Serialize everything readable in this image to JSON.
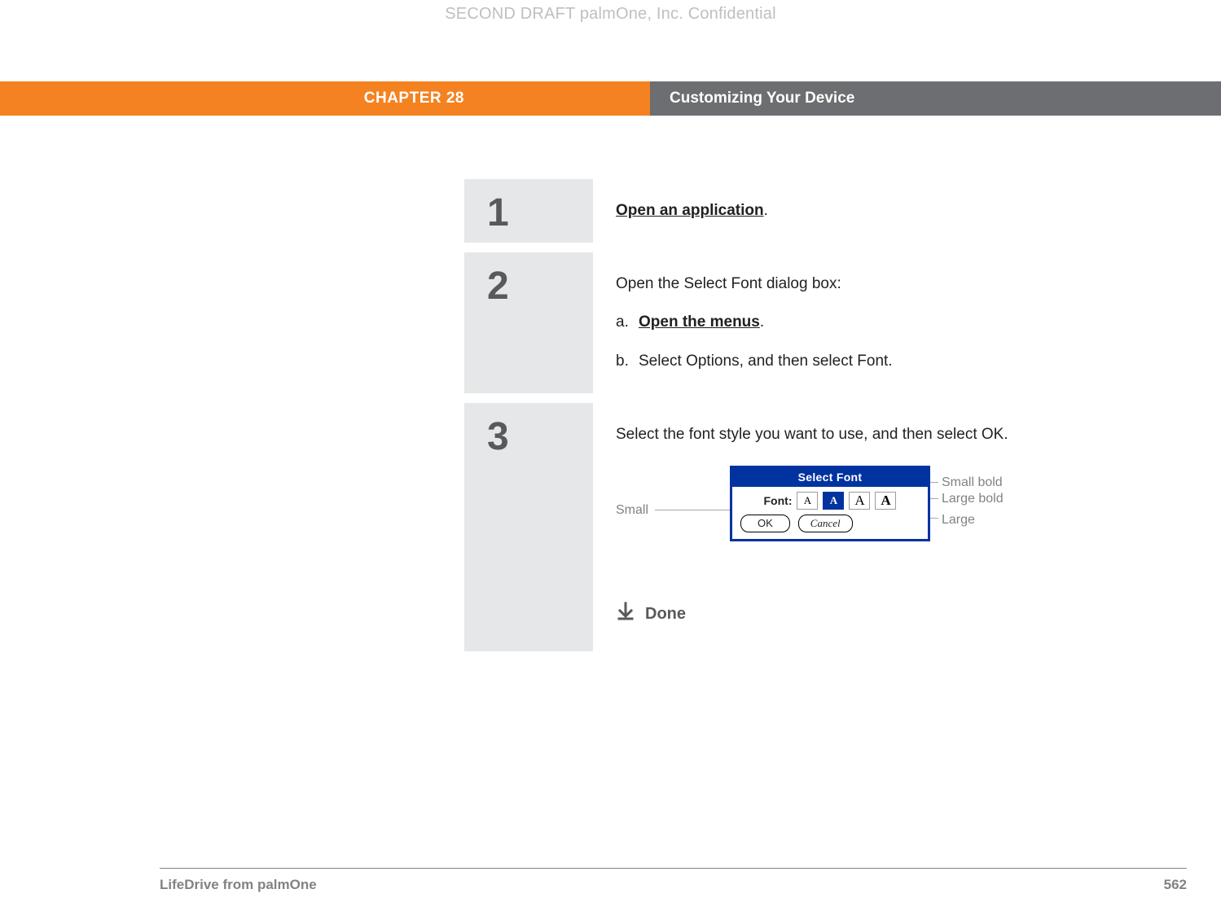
{
  "watermark": "SECOND DRAFT palmOne, Inc.  Confidential",
  "header": {
    "chapter": "CHAPTER 28",
    "title": "Customizing Your Device"
  },
  "steps": {
    "s1": {
      "num": "1",
      "link": "Open an application",
      "period": "."
    },
    "s2": {
      "num": "2",
      "intro": "Open the Select Font dialog box:",
      "a_label": "a.",
      "a_link": "Open the menus",
      "a_period": ".",
      "b_label": "b.",
      "b_text": "Select Options, and then select Font."
    },
    "s3": {
      "num": "3",
      "text": "Select the font style you want to use, and then select OK.",
      "callouts": {
        "small": "Small",
        "small_bold": "Small bold",
        "large_bold": "Large bold",
        "large": "Large"
      },
      "dialog": {
        "title": "Select Font",
        "label": "Font:",
        "options": {
          "o1": "A",
          "o2": "A",
          "o3": "A",
          "o4": "A"
        },
        "ok": "OK",
        "cancel": "Cancel"
      },
      "done": "Done"
    }
  },
  "footer": {
    "product": "LifeDrive from palmOne",
    "page": "562"
  }
}
